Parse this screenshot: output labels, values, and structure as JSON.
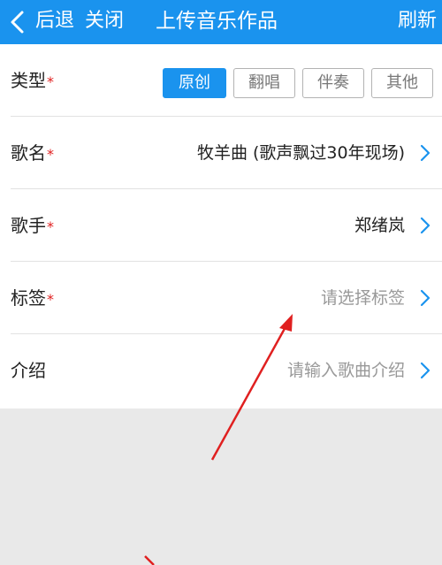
{
  "nav": {
    "back_label": "后退",
    "close_label": "关闭",
    "title": "上传音乐作品",
    "refresh_label": "刷新"
  },
  "form": {
    "type": {
      "label": "类型",
      "options": [
        "原创",
        "翻唱",
        "伴奏",
        "其他"
      ],
      "selected": "原创"
    },
    "song_name": {
      "label": "歌名",
      "value": "牧羊曲 (歌声飘过30年现场)"
    },
    "singer": {
      "label": "歌手",
      "value": "郑绪岚"
    },
    "tags": {
      "label": "标签",
      "placeholder": "请选择标签"
    },
    "intro": {
      "label": "介绍",
      "placeholder": "请输入歌曲介绍"
    },
    "required_mark": "*"
  },
  "colors": {
    "accent": "#1a93ee",
    "required": "#e02020",
    "annotation_arrow": "#e02020"
  }
}
